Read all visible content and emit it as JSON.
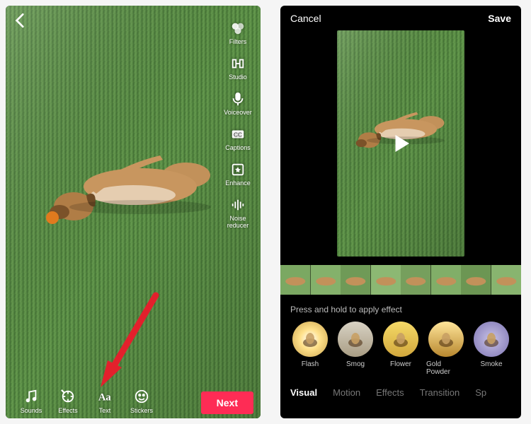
{
  "left": {
    "sideTools": [
      {
        "name": "filters-button",
        "icon": "filters-icon",
        "label": "Filters"
      },
      {
        "name": "studio-button",
        "icon": "studio-icon",
        "label": "Studio"
      },
      {
        "name": "voiceover-button",
        "icon": "voiceover-icon",
        "label": "Voiceover"
      },
      {
        "name": "captions-button",
        "icon": "captions-icon",
        "label": "Captions"
      },
      {
        "name": "enhance-button",
        "icon": "enhance-icon",
        "label": "Enhance"
      },
      {
        "name": "noise-reducer-button",
        "icon": "noise-reducer-icon",
        "label": "Noise reducer"
      }
    ],
    "bottomTools": [
      {
        "name": "sounds-button",
        "icon": "sounds-icon",
        "label": "Sounds"
      },
      {
        "name": "effects-button",
        "icon": "effects-icon",
        "label": "Effects"
      },
      {
        "name": "text-button",
        "icon": "text-icon",
        "label": "Text"
      },
      {
        "name": "stickers-button",
        "icon": "stickers-icon",
        "label": "Stickers"
      }
    ],
    "nextLabel": "Next"
  },
  "right": {
    "cancel": "Cancel",
    "save": "Save",
    "hint": "Press and hold to apply effect",
    "effects": [
      {
        "name": "effect-flash",
        "label": "Flash"
      },
      {
        "name": "effect-smog",
        "label": "Smog"
      },
      {
        "name": "effect-flower",
        "label": "Flower"
      },
      {
        "name": "effect-gold-powder",
        "label": "Gold Powder"
      },
      {
        "name": "effect-smoke",
        "label": "Smoke"
      }
    ],
    "tabs": [
      {
        "name": "tab-visual",
        "label": "Visual",
        "active": true
      },
      {
        "name": "tab-motion",
        "label": "Motion"
      },
      {
        "name": "tab-effects",
        "label": "Effects"
      },
      {
        "name": "tab-transition",
        "label": "Transition"
      },
      {
        "name": "tab-split",
        "label": "Sp"
      }
    ]
  }
}
